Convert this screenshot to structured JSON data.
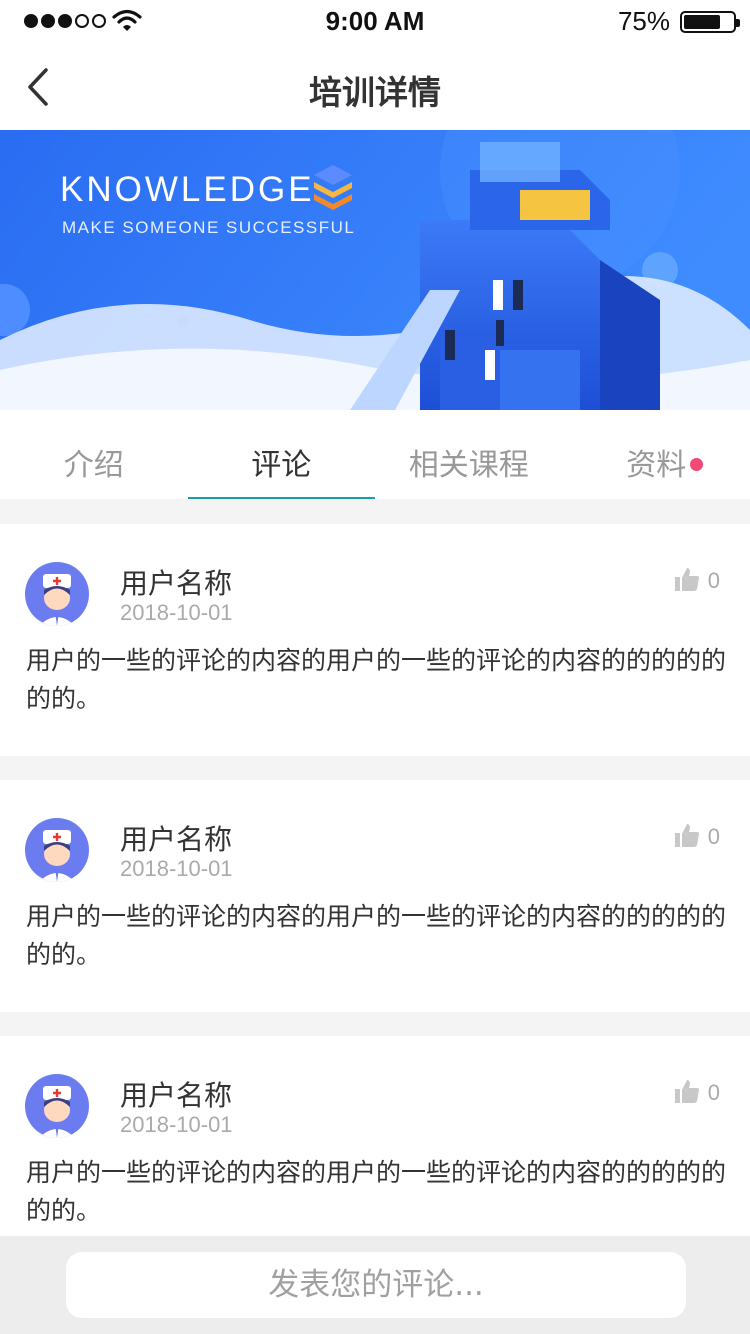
{
  "status_bar": {
    "time": "9:00 AM",
    "battery_text": "75%",
    "battery_level": 0.75,
    "signal_bars_filled": 3,
    "signal_bars_total": 5
  },
  "nav": {
    "title": "培训详情",
    "back_icon": "chevron-left-icon"
  },
  "banner": {
    "headline": "KNOWLEDGE",
    "subline": "MAKE SOMEONE SUCCESSFUL",
    "colors": {
      "primary": "#2f6bf0",
      "light": "#6fb0ff"
    }
  },
  "tabs": [
    {
      "label": "介绍",
      "active": false
    },
    {
      "label": "评论",
      "active": true
    },
    {
      "label": "相关课程",
      "active": false
    },
    {
      "label": "资料",
      "active": false,
      "badge": true
    }
  ],
  "accent_color": "#18a0a8",
  "badge_color": "#f24875",
  "comments": [
    {
      "user": "用户名称",
      "date": "2018-10-01",
      "likes": "0",
      "text": "用户的一些的评论的内容的用户的一些的评论的内容的的的的的的的。"
    },
    {
      "user": "用户名称",
      "date": "2018-10-01",
      "likes": "0",
      "text": "用户的一些的评论的内容的用户的一些的评论的内容的的的的的的的。"
    },
    {
      "user": "用户名称",
      "date": "2018-10-01",
      "likes": "0",
      "text": "用户的一些的评论的内容的用户的一些的评论的内容的的的的的的的。"
    }
  ],
  "composer": {
    "placeholder": "发表您的评论..."
  }
}
